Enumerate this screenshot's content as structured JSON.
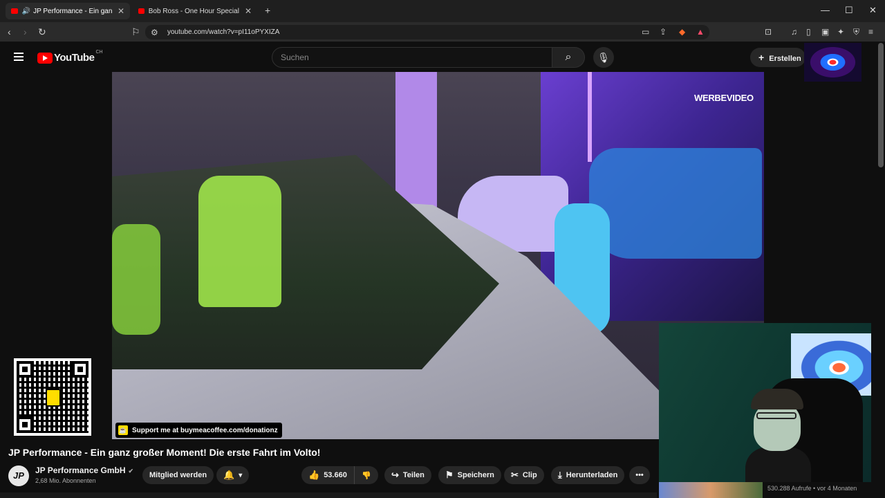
{
  "browser": {
    "tabs": [
      {
        "title": "JP Performance - Ein ganz gr",
        "active": true
      },
      {
        "title": "Bob Ross - One Hour Special - The G",
        "active": false
      }
    ],
    "url": "youtube.com/watch?v=pI11oPYXIZA"
  },
  "header": {
    "logo_text": "YouTube",
    "country_code": "CH",
    "search_placeholder": "Suchen",
    "create_label": "Erstellen"
  },
  "video": {
    "ad_label": "WERBEVIDEO",
    "overlay_text": "Support me at buymeacoffee.com/donationz"
  },
  "watch": {
    "title": "JP Performance - Ein ganz großer Moment! Die erste Fahrt im Volto!",
    "channel_name": "JP Performance GmbH",
    "channel_initials": "JP",
    "subscribers": "2,68 Mio. Abonnenten",
    "join_label": "Mitglied werden",
    "like_count": "53.660",
    "share_label": "Teilen",
    "save_label": "Speichern",
    "clip_label": "Clip",
    "download_label": "Herunterladen"
  },
  "suggestion": {
    "meta": "530.288 Aufrufe • vor 4 Monaten"
  },
  "colors": {
    "brand_red": "#ff0000",
    "background": "#0f0f0f",
    "pill": "#272727"
  }
}
